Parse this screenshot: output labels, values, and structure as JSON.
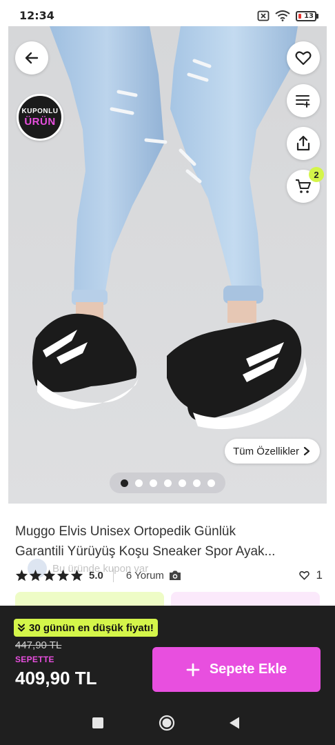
{
  "status_bar": {
    "time": "12:34",
    "battery_level": "13",
    "icons": [
      "notification-muted-icon",
      "wifi-icon",
      "battery-icon"
    ]
  },
  "product_gallery": {
    "coupon_badge": {
      "line1": "KUPONLU",
      "line2": "ÜRÜN"
    },
    "cart_count": "2",
    "all_features_label": "Tüm Özellikler",
    "image_count": 7,
    "active_image_index": 0,
    "actions": [
      "back-icon",
      "heart-icon",
      "add-to-list-icon",
      "share-icon",
      "cart-icon"
    ]
  },
  "product": {
    "title_line1": "Muggo Elvis Unisex Ortopedik Günlük",
    "title_line2": "Garantili Yürüyüş Koşu Sneaker Spor Ayak...",
    "rating": "5.0",
    "stars": 5,
    "reviews_label": "6 Yorum",
    "favorites_count": "1",
    "coupon_hint": "Bu üründe kupon var"
  },
  "purchase_bar": {
    "lowest_price_label": "30 günün en düşük fiyatı!",
    "old_price": "447,90 TL",
    "in_cart_label": "SEPETTE",
    "final_price": "409,90 TL",
    "add_to_cart_label": "Sepete Ekle"
  },
  "colors": {
    "accent_pink": "#e84fdf",
    "accent_lime": "#d4f54a",
    "dark_bar": "#1f1f1f"
  }
}
